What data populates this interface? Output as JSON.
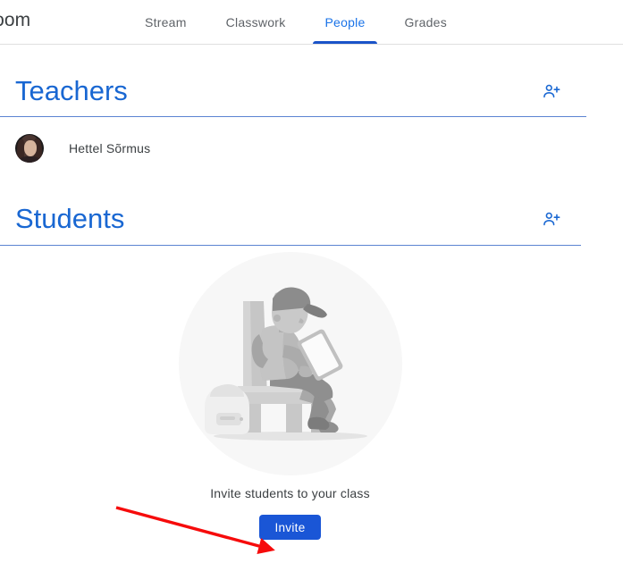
{
  "header": {
    "app_title": "room",
    "tabs": [
      {
        "label": "Stream",
        "active": false
      },
      {
        "label": "Classwork",
        "active": false
      },
      {
        "label": "People",
        "active": true
      },
      {
        "label": "Grades",
        "active": false
      }
    ],
    "active_tab": "People"
  },
  "sections": {
    "teachers": {
      "title": "Teachers",
      "invite_icon": "person-add-icon",
      "people": [
        {
          "name": "Hettel Sõrmus",
          "avatar": "teacher-avatar-photo"
        }
      ]
    },
    "students": {
      "title": "Students",
      "invite_icon": "person-add-icon",
      "people": [],
      "empty_state": {
        "illustration": "student-reading-on-bench-illustration",
        "caption": "Invite students to your class",
        "button_label": "Invite"
      }
    }
  },
  "annotation": {
    "type": "red-arrow",
    "color": "#f60b0b",
    "from": "upper-left",
    "to": "invite-button"
  },
  "colors": {
    "accent_blue": "#1a73e8",
    "section_title_blue": "#1967d2",
    "tab_indicator_blue": "#1a53c8",
    "divider_blue": "#5b84d2",
    "button_blue": "#1a56d6",
    "text_primary": "#3c4043",
    "text_secondary": "#5f6368",
    "header_border": "#e0e0e0",
    "illustration_circle": "#f7f7f7",
    "annotation_red": "#f60b0b"
  }
}
